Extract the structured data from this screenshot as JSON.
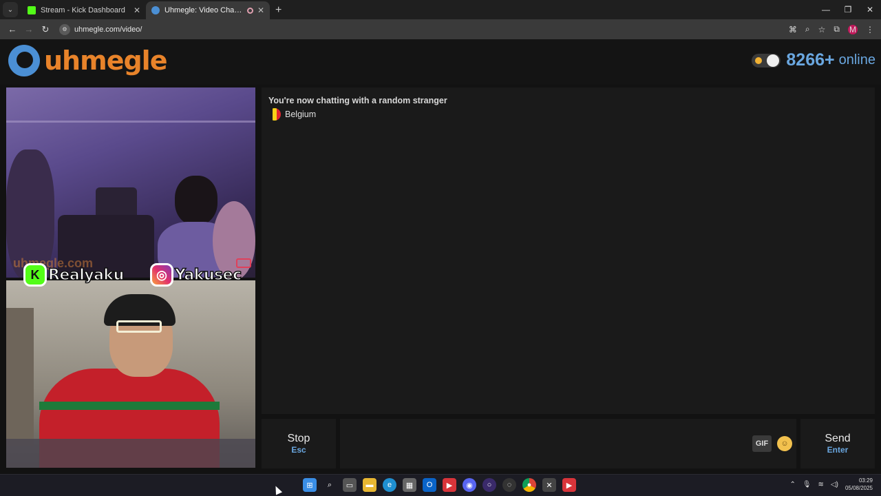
{
  "browser": {
    "tabs": [
      {
        "title": "Stream - Kick Dashboard",
        "favicon_color": "#53fc18"
      },
      {
        "title": "Uhmegle: Video Chat | Omegle Alternative",
        "favicon_color": "#4b8fd4"
      }
    ],
    "url": "uhmegle.com/video/",
    "profile_initial": "M"
  },
  "site": {
    "logo_text": "uhmegle",
    "online_count": "8266+",
    "online_label": "online"
  },
  "video": {
    "watermark": "uhmegle.com",
    "kick_handle": "Realyaku",
    "instagram_handle": "Yakusec"
  },
  "chat": {
    "status_message": "You're now chatting with a random stranger",
    "country": "Belgium",
    "flag_colors": [
      "#1b1b1b",
      "#f7d117",
      "#e0262e"
    ]
  },
  "controls": {
    "stop_label": "Stop",
    "stop_hint": "Esc",
    "gif_label": "GIF",
    "send_label": "Send",
    "send_hint": "Enter"
  },
  "taskbar": {
    "time": "03:29",
    "date": "05/08/2025",
    "icons": [
      "windows-icon",
      "search-icon",
      "taskview-icon",
      "file-explorer-icon",
      "edge-icon",
      "store-icon",
      "outlook-icon",
      "app-red-icon",
      "discord-icon",
      "app-purple-icon",
      "app-circle-icon",
      "chrome-icon",
      "xbox-icon",
      "app-red2-icon"
    ]
  },
  "colors": {
    "accent_blue": "#6aa7e0",
    "logo_orange": "#e8832a"
  }
}
